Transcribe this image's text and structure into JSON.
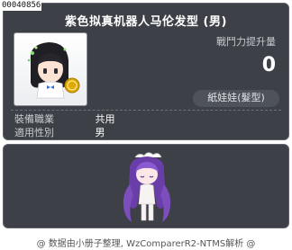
{
  "item_id": "00040856",
  "title": "紫色拟真机器人马伦发型 (男)",
  "icon": "hair-avatar-icon",
  "power": {
    "label": "戰鬥力提升量",
    "value": "0"
  },
  "type_badge": "紙娃娃(髮型)",
  "attributes": [
    {
      "label": "裝備職業",
      "value": "共用"
    },
    {
      "label": "適用性別",
      "value": "男"
    }
  ],
  "preview": "character-preview",
  "footer": "@ 数据由小册子整理, WzComparerR2-NTMS解析 @",
  "colors": {
    "panel": "#3d4046",
    "border": "#5f636b",
    "hair": "#6a3ea8",
    "coin": "#e0a800"
  }
}
